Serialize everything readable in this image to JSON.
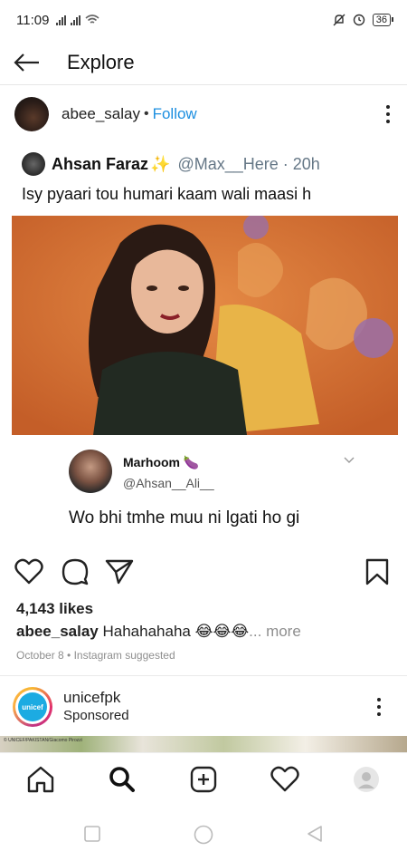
{
  "status_bar": {
    "time": "11:09",
    "battery": "36"
  },
  "header": {
    "title": "Explore"
  },
  "post": {
    "username": "abee_salay",
    "separator": "•",
    "follow_label": "Follow",
    "tweet": {
      "author_name": "Ahsan Faraz",
      "handle_time": "@Max__Here · 20h",
      "text": "Isy pyaari tou humari kaam wali maasi h",
      "reply": {
        "name": "Marhoom",
        "handle": "@Ahsan__Ali__",
        "text": "Wo bhi tmhe muu ni lgati ho gi"
      }
    },
    "likes": "4,143 likes",
    "caption_user": "abee_salay",
    "caption_text": "Hahahahaha 😂😂😂",
    "caption_more": "... more",
    "meta": "October 8 • Instagram suggested"
  },
  "next_post": {
    "username": "unicefpk",
    "sponsored": "Sponsored",
    "logo_text": "unicef",
    "image_credit": "© UNICEF/PAKISTAN/Giacomo Pirozzi"
  },
  "icons": [
    "back-arrow-icon",
    "more-options-icon",
    "heart-icon",
    "comment-icon",
    "share-icon",
    "bookmark-icon",
    "home-icon",
    "search-icon",
    "add-post-icon",
    "activity-heart-icon",
    "profile-icon"
  ]
}
